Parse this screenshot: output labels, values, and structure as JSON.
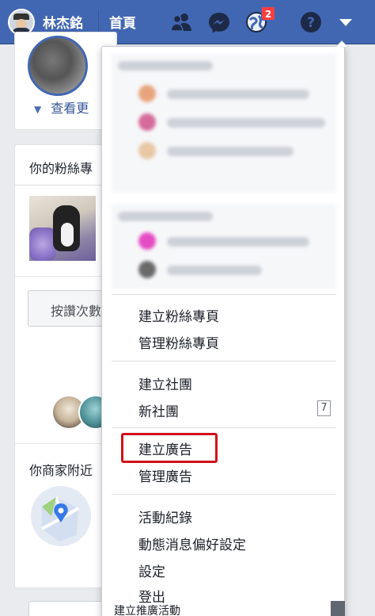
{
  "topbar": {
    "username": "林杰銘",
    "home": "首頁",
    "notification_count": "2",
    "icons": [
      "friends-icon",
      "messenger-icon",
      "notifications-icon",
      "help-icon",
      "caret-down-icon"
    ]
  },
  "left": {
    "see_more": "查看更",
    "fans_title": "你的粉絲專",
    "like_button": "按讚次數",
    "nearby": "你商家附近"
  },
  "dropdown": {
    "group1": [
      {
        "label": "建立粉絲專頁"
      },
      {
        "label": "管理粉絲專頁"
      }
    ],
    "group2": [
      {
        "label": "建立社團"
      },
      {
        "label": "新社團",
        "count": "7"
      }
    ],
    "group3": [
      {
        "label": "建立廣告"
      },
      {
        "label": "管理廣告"
      }
    ],
    "group4": [
      {
        "label": "活動紀錄"
      },
      {
        "label": "動態消息偏好設定"
      },
      {
        "label": "設定"
      },
      {
        "label": "登出"
      }
    ],
    "peek_text": "建立推廣活動"
  },
  "colors": {
    "brand": "#4267b2",
    "highlight": "#d0111a",
    "badge": "#fa3e3e"
  }
}
